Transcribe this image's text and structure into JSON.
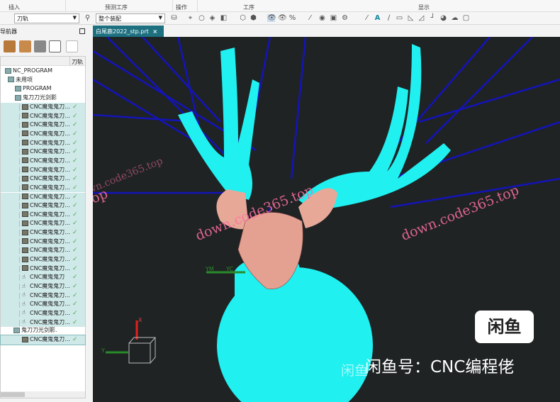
{
  "ribbon_groups": [
    "插入",
    "预测工序",
    "操作",
    "工序",
    "显示"
  ],
  "toolbar": {
    "filter_value": "刀轨",
    "assembly_value": "整个装配"
  },
  "navigator": {
    "title": "导航器",
    "column_toolpath": "刀轨",
    "nodes": [
      {
        "label": "NC_PROGRAM",
        "type": "folder",
        "level": 0
      },
      {
        "label": "未用项",
        "type": "folder",
        "level": 1
      },
      {
        "label": "PROGRAM",
        "type": "folder",
        "level": 2
      },
      {
        "label": "鬼刀刀光剑影",
        "type": "folder",
        "level": 2
      }
    ],
    "group1_ops": [
      "CNC魔鬼鬼刀...",
      "CNC魔鬼鬼刀...",
      "CNC魔鬼鬼刀...",
      "CNC魔鬼鬼刀...",
      "CNC魔鬼鬼刀...",
      "CNC魔鬼鬼刀...",
      "CNC魔鬼鬼刀...",
      "CNC魔鬼鬼刀...",
      "CNC魔鬼鬼刀...",
      "CNC魔鬼鬼刀...",
      "CNC魔鬼鬼刀...",
      "CNC魔鬼鬼刀...",
      "CNC魔鬼鬼刀...",
      "CNC魔鬼鬼刀...",
      "CNC魔鬼鬼刀...",
      "CNC魔鬼鬼刀...",
      "CNC魔鬼鬼刀...",
      "CNC魔鬼鬼刀...",
      "CNC魔鬼鬼刀...",
      "CNC魔鬼鬼刀",
      "CNC魔鬼鬼刀...",
      "CNC魔鬼鬼刀...",
      "CNC魔鬼鬼刀...",
      "CNC魔鬼鬼刀...",
      "CNC魔鬼鬼刀..."
    ],
    "group1_hand_from": 19,
    "group2": {
      "label": "鬼刀刀光剑影.",
      "ops": [
        "CNC魔鬼鬼刀..."
      ]
    },
    "check_mark": "✓"
  },
  "tab": {
    "label": "白尾鹿2022_stp.prt",
    "close": "×"
  },
  "viewport": {
    "axis_labels": {
      "ym": "YM",
      "yc": "YC",
      "x": "X",
      "y": "Y"
    },
    "watermarks": [
      "down.code365.top",
      "down.code365.top",
      "down.code365.top",
      "down.code365.top"
    ],
    "xianyu_logo": "闲鱼",
    "xianyu_text": "闲鱼号：CNC编程佬",
    "xianyu_ghost": "闲鱼"
  },
  "colors": {
    "model": "#20f0f0",
    "toolpath": "#1010b0",
    "head": "#e8a898",
    "background": "#1f2324",
    "tab": "#1d7080"
  }
}
